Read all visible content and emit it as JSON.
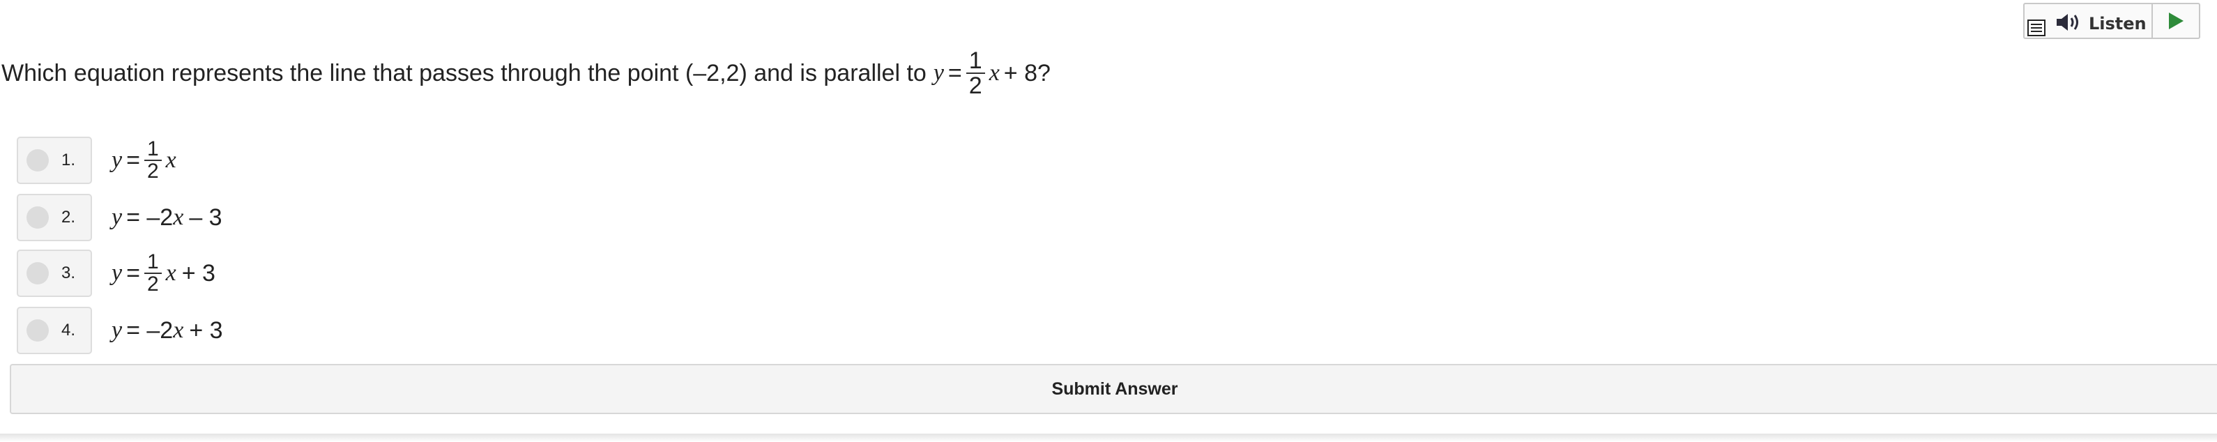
{
  "toolbar": {
    "listen_label": "Listen",
    "icons": [
      "menu-icon",
      "speaker-icon",
      "play-icon"
    ],
    "play_color": "#2e8b3a"
  },
  "question": {
    "text_before": "Which equation represents the line that passes through the point (–2,2) and is parallel to",
    "var": "y",
    "equals": "=",
    "frac_num": "1",
    "frac_den": "2",
    "after_frac_var": "x",
    "tail": "+ 8?"
  },
  "options": [
    {
      "number": "1.",
      "var_y": "y",
      "eq": "=",
      "num": "1",
      "den": "2",
      "var_x": "x",
      "rest": ""
    },
    {
      "number": "2.",
      "var_y": "y",
      "eq": "= –2",
      "var_x": "x",
      "rest": "– 3"
    },
    {
      "number": "3.",
      "var_y": "y",
      "eq": "=",
      "num": "1",
      "den": "2",
      "var_x": "x",
      "rest": "+ 3"
    },
    {
      "number": "4.",
      "var_y": "y",
      "eq": "= –2",
      "var_x": "x",
      "rest": "+ 3"
    }
  ],
  "submit_label": "Submit Answer"
}
